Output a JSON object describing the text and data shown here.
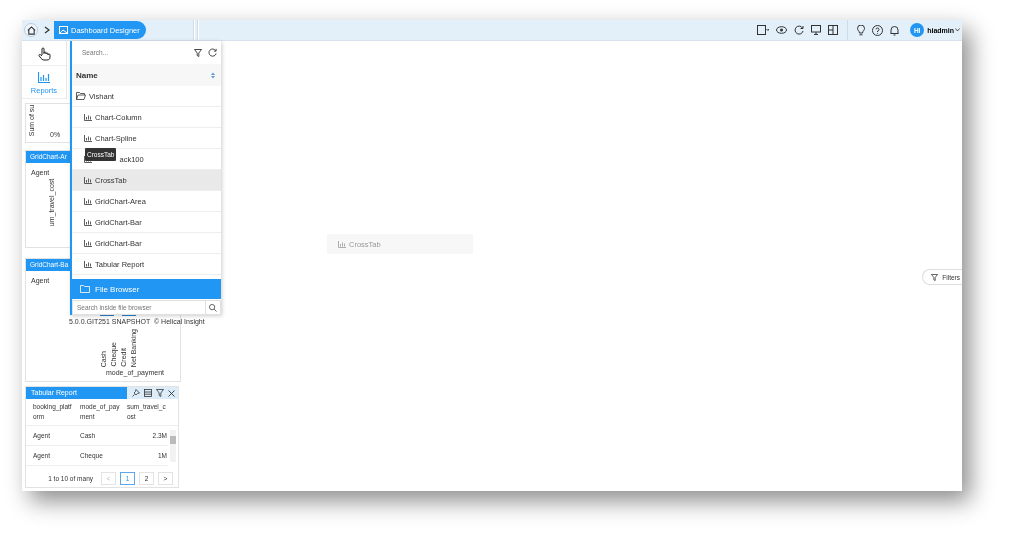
{
  "breadcrumb": {
    "current": "Dashboard Designer"
  },
  "user": {
    "initials": "HI",
    "name": "hiadmin"
  },
  "sidebar": {
    "items": [
      {
        "label": "Reports",
        "selected": true
      }
    ]
  },
  "chart_widget": {
    "axis_label": "Sum of su",
    "tick": "0%"
  },
  "widgets": [
    {
      "kind": "gridchart",
      "title": "GridChart-Ar",
      "row_label": "Agent",
      "measure": "um_travel_cost"
    },
    {
      "kind": "bar",
      "title": "GridChart-Ba",
      "row_label": "Agent",
      "version": "5.0.0.GIT251 SNAPSHOT",
      "brand": "© Helical Insight",
      "categories": [
        "Cash",
        "Cheque",
        "Credit",
        "Net Banking"
      ],
      "xlabel": "mode_of_payment"
    }
  ],
  "table_widget": {
    "title": "Tabular Report",
    "columns": [
      "booking_platform",
      "mode_of_payment",
      "sum_travel_cost"
    ],
    "rows": [
      [
        "Agent",
        "Cash",
        "2.3M"
      ],
      [
        "Agent",
        "Cheque",
        "1M"
      ]
    ],
    "summary": "1 to 10 of many",
    "prev": "<",
    "next": ">",
    "pages": [
      {
        "label": "1",
        "selected": true
      },
      {
        "label": "2",
        "selected": false
      }
    ]
  },
  "file_browser": {
    "search_placeholder": "Search...",
    "column": "Name",
    "folder": "Vishant",
    "items": [
      {
        "label": "Chart-Column",
        "hovered": false
      },
      {
        "label": "Chart-Spline",
        "hovered": false
      },
      {
        "label": "ack100",
        "hovered": false,
        "tooltip": "CrossTab"
      },
      {
        "label": "CrossTab",
        "hovered": true
      },
      {
        "label": "GridChart-Area",
        "hovered": false
      },
      {
        "label": "GridChart-Bar",
        "hovered": false
      },
      {
        "label": "GridChart-Bar",
        "hovered": false
      },
      {
        "label": "Tabular Report",
        "hovered": false
      }
    ],
    "footer": "File Browser",
    "file_search_placeholder": "Search inside file browser"
  },
  "drag_ghost": "CrossTab",
  "filters_button": "Filters"
}
